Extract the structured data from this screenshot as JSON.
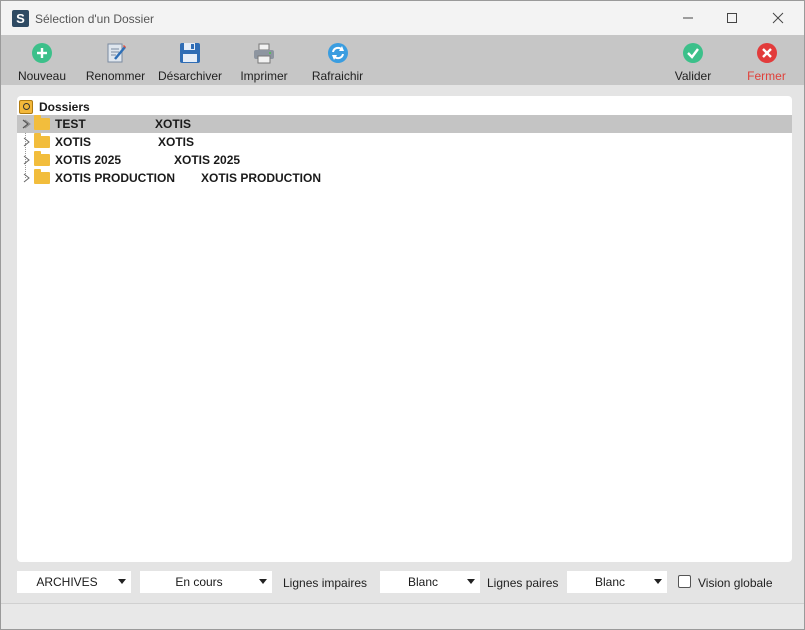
{
  "window": {
    "title": "Sélection d'un Dossier",
    "app_icon_letter": "S"
  },
  "toolbar": {
    "nouveau": "Nouveau",
    "renommer": "Renommer",
    "desarchiver": "Désarchiver",
    "imprimer": "Imprimer",
    "rafraichir": "Rafraichir",
    "valider": "Valider",
    "fermer": "Fermer"
  },
  "tree": {
    "root_label": "Dossiers",
    "rows": [
      {
        "name": "TEST",
        "company": "XOTIS",
        "selected": true
      },
      {
        "name": "XOTIS",
        "company": "XOTIS",
        "selected": false
      },
      {
        "name": "XOTIS 2025",
        "company": "XOTIS 2025",
        "selected": false
      },
      {
        "name": "XOTIS PRODUCTION",
        "company": "XOTIS PRODUCTION",
        "selected": false
      }
    ]
  },
  "bottom": {
    "archives_value": "ARCHIVES",
    "status_value": "En cours",
    "lignes_impaires_label": "Lignes impaires",
    "lignes_impaires_value": "Blanc",
    "lignes_paires_label": "Lignes paires",
    "lignes_paires_value": "Blanc",
    "vision_globale_label": "Vision globale",
    "vision_globale_checked": false
  },
  "colors": {
    "toolbar_bg": "#c6c6c6",
    "selected_row": "#c4c4c4",
    "accent_green": "#3cc08a",
    "accent_red": "#e23b3b",
    "folder": "#f2bd3c"
  }
}
